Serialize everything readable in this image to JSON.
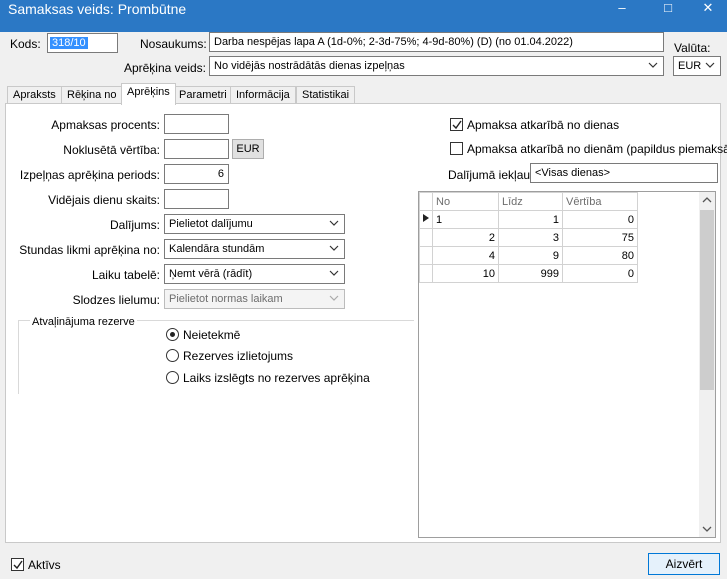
{
  "window": {
    "title": "Samaksas veids: Prombūtne",
    "minimize": "–",
    "maximize": "□",
    "close": "✕"
  },
  "header": {
    "kods_label": "Kods:",
    "kods_value": "318/10",
    "nosaukums_label": "Nosaukums:",
    "nosaukums_value": "Darba nespējas lapa A (1d-0%; 2-3d-75%; 4-9d-80%) (D) (no 01.04.2022)",
    "aprekina_veids_label": "Aprēķina veids:",
    "aprekina_veids_value": "No vidējās nostrādātās dienas izpeļņas",
    "valuta_label": "Valūta:",
    "valuta_value": "EUR"
  },
  "tabs": [
    {
      "label": "Apraksts"
    },
    {
      "label": "Rēķina no"
    },
    {
      "label": "Aprēķins"
    },
    {
      "label": "Parametri"
    },
    {
      "label": "Informācija"
    },
    {
      "label": "Statistikai"
    }
  ],
  "form": {
    "apmaksas_procents_label": "Apmaksas procents:",
    "apmaksas_procents_value": "",
    "nokluseta_vertiba_label": "Noklusētā vērtība:",
    "nokluseta_vertiba_value": "",
    "currency_button": "EUR",
    "izpelnas_periods_label": "Izpeļņas aprēķina periods:",
    "izpelnas_periods_value": "6",
    "videjais_dienu_label": "Vidējais dienu skaits:",
    "videjais_dienu_value": "",
    "dalijums_label": "Dalījums:",
    "dalijums_value": "Pielietot dalījumu",
    "stundas_likmi_label": "Stundas likmi aprēķina no:",
    "stundas_likmi_value": "Kalendāra stundām",
    "laiku_tabele_label": "Laiku tabelē:",
    "laiku_tabele_value": "Ņemt vērā (rādīt)",
    "slodzes_lielumu_label": "Slodzes lielumu:",
    "slodzes_lielumu_value": "Pielietot normas laikam"
  },
  "reserve": {
    "legend": "Atvaļinājuma rezerve",
    "options": [
      {
        "label": "Neietekmē",
        "selected": true
      },
      {
        "label": "Rezerves izlietojums",
        "selected": false
      },
      {
        "label": "Laiks izslēgts no rezerves aprēķina",
        "selected": false
      }
    ]
  },
  "right": {
    "apmaksa_atkariba_label": "Apmaksa atkarībā no dienas",
    "apmaksa_atkariba_checked": true,
    "apmaksa_papildus_label": "Apmaksa atkarībā no dienām (papildus piemaksām)",
    "apmaksa_papildus_checked": false,
    "dalijuma_iekl_label": "Dalījumā iekļaut:",
    "dalijuma_iekl_value": "<Visas dienas>"
  },
  "grid": {
    "columns": [
      "No",
      "Līdz",
      "Vērtība"
    ],
    "rows": [
      {
        "no": "1",
        "lidz": "1",
        "vertiba": "0"
      },
      {
        "no": "2",
        "lidz": "3",
        "vertiba": "75"
      },
      {
        "no": "4",
        "lidz": "9",
        "vertiba": "80"
      },
      {
        "no": "10",
        "lidz": "999",
        "vertiba": "0"
      }
    ]
  },
  "footer": {
    "aktivs_label": "Aktīvs",
    "aktivs_checked": true,
    "close_button": "Aizvērt"
  }
}
